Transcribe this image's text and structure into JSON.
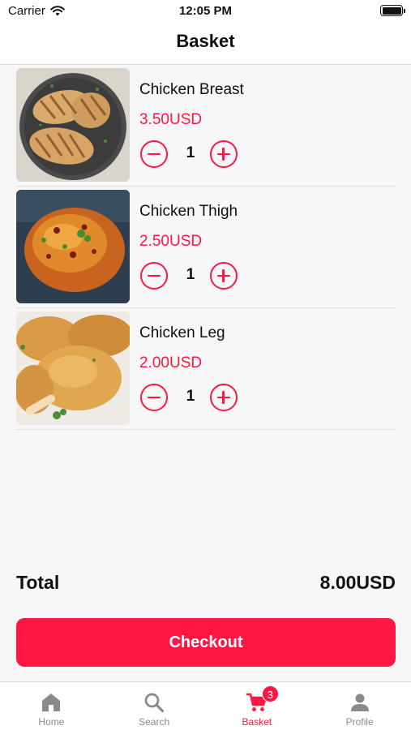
{
  "status_bar": {
    "carrier": "Carrier",
    "time": "12:05 PM"
  },
  "header": {
    "title": "Basket"
  },
  "items": [
    {
      "name": "Chicken Breast",
      "price": "3.50USD",
      "quantity": "1"
    },
    {
      "name": "Chicken Thigh",
      "price": "2.50USD",
      "quantity": "1"
    },
    {
      "name": "Chicken Leg",
      "price": "2.00USD",
      "quantity": "1"
    }
  ],
  "total": {
    "label": "Total",
    "value": "8.00USD"
  },
  "checkout": {
    "label": "Checkout"
  },
  "tabs": [
    {
      "label": "Home",
      "icon": "home-icon"
    },
    {
      "label": "Search",
      "icon": "search-icon"
    },
    {
      "label": "Basket",
      "icon": "cart-icon",
      "badge": "3",
      "active": true
    },
    {
      "label": "Profile",
      "icon": "person-icon"
    }
  ],
  "colors": {
    "accent": "#ff1744",
    "inactive": "#8a8a8a",
    "background": "#f7f7f7"
  }
}
